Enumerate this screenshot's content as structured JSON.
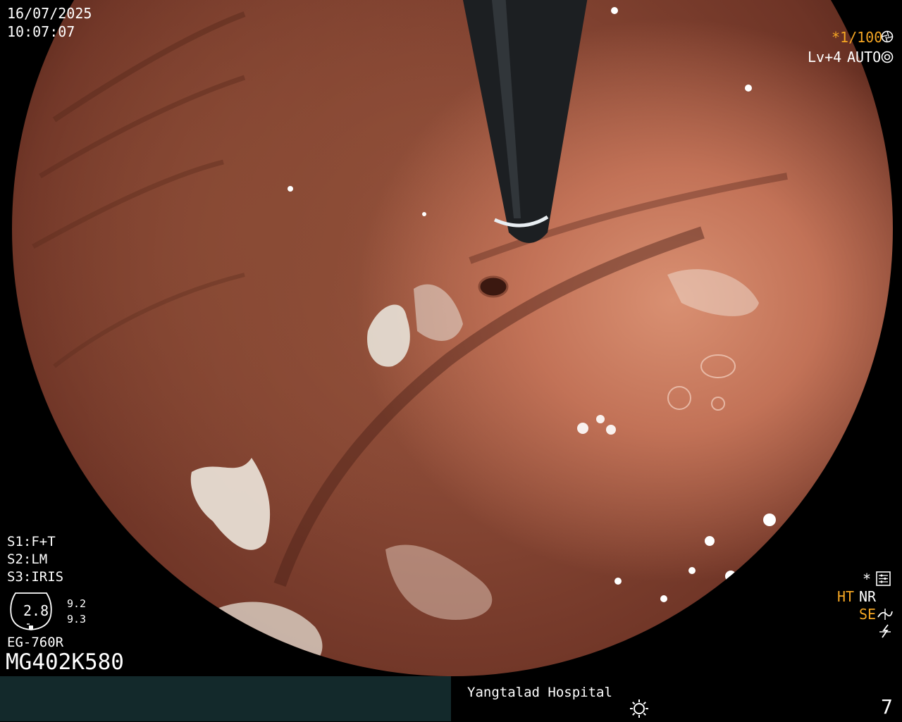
{
  "datetime": {
    "date": "16/07/2025",
    "time": "10:07:07"
  },
  "top_right": {
    "shutter": "*1/100",
    "shutter_icon": "aperture-icon",
    "level": "Lv+4",
    "mode": "AUTO",
    "mode_icon": "auto-exposure-icon"
  },
  "settings": {
    "s1": "S1:F+T",
    "s2": "S2:LM",
    "s3": "S3:IRIS"
  },
  "scale": {
    "center": "2.8",
    "top": "9.2",
    "bottom": "9.3"
  },
  "scope": {
    "model": "EG-760R",
    "serial": "MG402K580"
  },
  "right_panel": {
    "star": "*",
    "settings_icon": "enhancement-settings-icon",
    "ht": "HT",
    "nr": "NR",
    "se": "SE",
    "se_icon": "structure-enhancement-icon",
    "flash_icon": "lightning-icon"
  },
  "footer": {
    "hospital": "Yangtalad Hospital",
    "light_icon": "light-source-icon",
    "counter": "7"
  },
  "colors": {
    "overlay_text": "#ffffff",
    "accent_orange": "#f5a623",
    "footer_bar": "#13292b",
    "mucosa": "#b0664a"
  }
}
